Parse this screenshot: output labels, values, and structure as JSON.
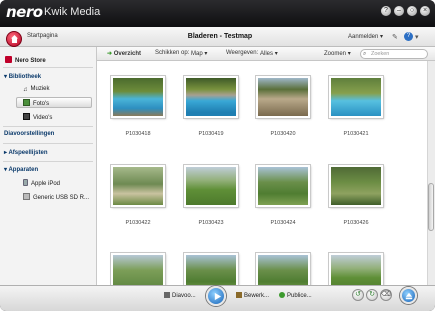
{
  "app": {
    "brand": "nero",
    "title": "Kwik Media"
  },
  "window_buttons": [
    "?",
    "–",
    "○",
    "×"
  ],
  "topbar": {
    "breadcrumb": "Startpagina",
    "page_title": "Bladeren - Testmap",
    "signin": "Aanmelden",
    "signin_caret": "▾"
  },
  "sidebar": {
    "store": "Nero Store",
    "library": "Bibliotheek",
    "music": "Muziek",
    "photos": "Foto's",
    "videos": "Video's",
    "slideshows": "Diavoorstellingen",
    "playlists": "Afspeellijsten",
    "devices": "Apparaten",
    "device1": "Apple iPod",
    "device2": "Generic USB SD R..."
  },
  "gridbar": {
    "overview": "Overzicht",
    "arrange_label": "Schikken op:",
    "arrange_value": "Map",
    "view_label": "Weergeven:",
    "view_value": "Alles",
    "zoom": "Zoomen",
    "search_placeholder": "Zoeken"
  },
  "photos": [
    {
      "caption": "P1030418",
      "scene": "pool"
    },
    {
      "caption": "P1030419",
      "scene": "pool2"
    },
    {
      "caption": "P1030420",
      "scene": "house1"
    },
    {
      "caption": "P1030421",
      "scene": "pool3"
    },
    {
      "caption": "P1030422",
      "scene": "person"
    },
    {
      "caption": "P1030423",
      "scene": "field"
    },
    {
      "caption": "P1030424",
      "scene": "palms"
    },
    {
      "caption": "P1030426",
      "scene": "person2"
    },
    {
      "caption": "",
      "scene": "green"
    },
    {
      "caption": "",
      "scene": "palms"
    },
    {
      "caption": "",
      "scene": "palms"
    },
    {
      "caption": "",
      "scene": "field"
    }
  ],
  "bottombar": {
    "slideshow": "Diavoo...",
    "edit": "Bewerk...",
    "publish": "Publice..."
  },
  "colors": {
    "accent": "#1663b8",
    "home": "#c0002a",
    "titlebar": "#1b1b1d"
  }
}
